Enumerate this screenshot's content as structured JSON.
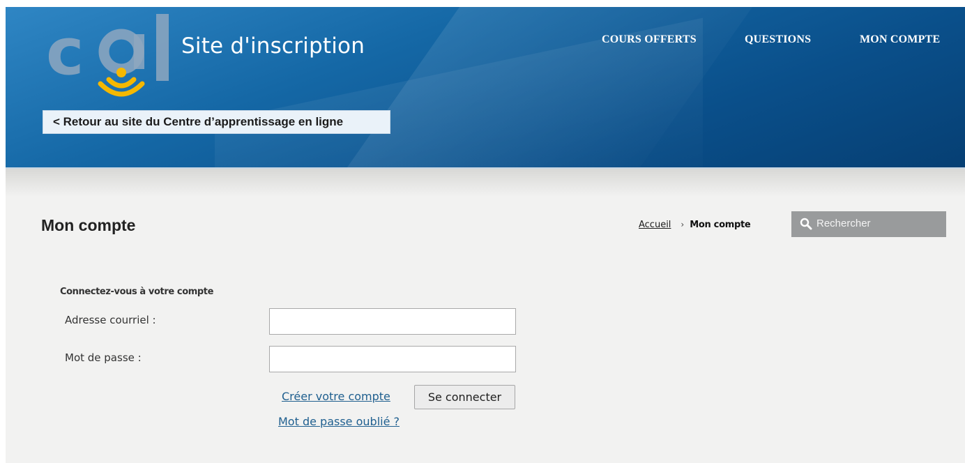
{
  "header": {
    "logo_text": "cal",
    "site_title": "Site d'inscription",
    "back_link": "< Retour au site du Centre d’apprentissage en ligne",
    "nav": [
      "COURS OFFERTS",
      "QUESTIONS",
      "MON COMPTE"
    ],
    "colors": {
      "header_blue": "#0a4f8a",
      "logo_yellow": "#f5b800",
      "logo_gray": "#8ea7bf"
    }
  },
  "page": {
    "title": "Mon compte",
    "breadcrumb": {
      "home": "Accueil",
      "separator": "›",
      "current": "Mon compte"
    },
    "search": {
      "placeholder": "Rechercher",
      "icon": "search-icon"
    }
  },
  "login": {
    "heading": "Connectez-vous à votre compte",
    "email_label": "Adresse courriel :",
    "email_value": "",
    "password_label": "Mot de passe :",
    "password_value": "",
    "create_account": "Créer votre compte",
    "submit": "Se connecter",
    "forgot_password": "Mot de passe oublié ?"
  }
}
